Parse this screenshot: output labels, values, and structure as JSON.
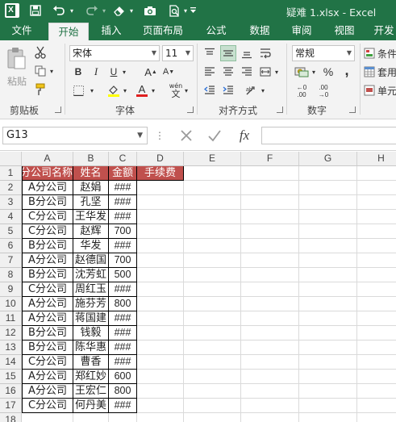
{
  "window": {
    "title": "疑难 1.xlsx - Excel",
    "app_logo": "X"
  },
  "tabs": [
    "文件",
    "开始",
    "插入",
    "页面布局",
    "公式",
    "数据",
    "审阅",
    "视图",
    "开发"
  ],
  "active_tab": "开始",
  "ribbon": {
    "clipboard": {
      "paste_label": "粘贴",
      "group_label": "剪贴板"
    },
    "font": {
      "font_name": "宋体",
      "font_size": "11",
      "bold": "B",
      "italic": "I",
      "underline": "U",
      "grow": "A",
      "shrink": "A",
      "color_letter": "A",
      "wen": "wén",
      "wen_char": "文",
      "group_label": "字体"
    },
    "alignment": {
      "group_label": "对齐方式"
    },
    "number": {
      "format": "常规",
      "percent": "%",
      "comma": ",",
      "group_label": "数字",
      "dec_inc": ".00",
      "dec_dec": ".00"
    },
    "styles": {
      "conditional": "条件",
      "table": "套用",
      "cell": "单元"
    }
  },
  "formula_bar": {
    "name_box": "G13",
    "fx": "fx",
    "formula": ""
  },
  "sheet": {
    "columns": [
      "A",
      "B",
      "C",
      "D",
      "E",
      "F",
      "G",
      "H"
    ],
    "rows": [
      "1",
      "2",
      "3",
      "4",
      "5",
      "6",
      "7",
      "8",
      "9",
      "10",
      "11",
      "12",
      "13",
      "14",
      "15",
      "16",
      "17",
      "18"
    ],
    "header": [
      "分公司名称",
      "姓名",
      "金额",
      "手续费"
    ],
    "data": [
      [
        "A分公司",
        "赵娟",
        "###"
      ],
      [
        "B分公司",
        "孔坚",
        "###"
      ],
      [
        "C分公司",
        "王华发",
        "###"
      ],
      [
        "C分公司",
        "赵辉",
        "700"
      ],
      [
        "B分公司",
        "华发",
        "###"
      ],
      [
        "A分公司",
        "赵德国",
        "700"
      ],
      [
        "B分公司",
        "沈芳虹",
        "500"
      ],
      [
        "C分公司",
        "周红玉",
        "###"
      ],
      [
        "A分公司",
        "施芬芳",
        "800"
      ],
      [
        "A分公司",
        "蒋国建",
        "###"
      ],
      [
        "B分公司",
        "钱毅",
        "###"
      ],
      [
        "B分公司",
        "陈华惠",
        "###"
      ],
      [
        "C分公司",
        "曹香",
        "###"
      ],
      [
        "A分公司",
        "郑红妙",
        "600"
      ],
      [
        "A分公司",
        "王宏仁",
        "800"
      ],
      [
        "C分公司",
        "何丹美",
        "###"
      ]
    ],
    "selected_cell": "G13"
  },
  "colors": {
    "excel_green": "#217346",
    "header_fill": "#c0504d"
  }
}
